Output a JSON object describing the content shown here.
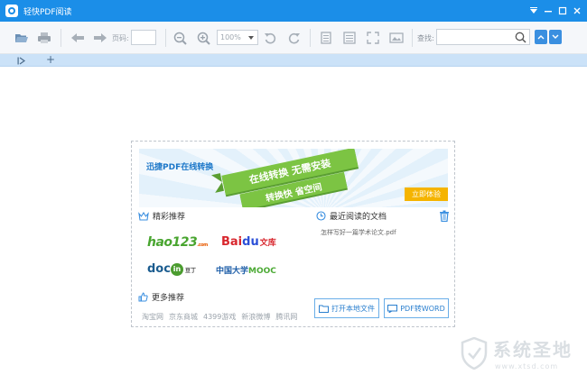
{
  "app": {
    "title": "轻快PDF阅读",
    "accent_color": "#1b8ee8"
  },
  "toolbar": {
    "page_label": "页码:",
    "page_value": "",
    "zoom_value": "100%",
    "find_label": "查找:",
    "find_value": ""
  },
  "tabs": {
    "new_tab": "+"
  },
  "start_panel": {
    "banner": {
      "title": "迅捷PDF在线转换",
      "ribbon_main": "在线转换 无需安装",
      "ribbon_sub": "转换快 省空间",
      "try_button": "立即体验"
    },
    "recommend": {
      "heading": "精彩推荐",
      "logos": [
        {
          "name": "hao123",
          "text": "hao123",
          "suffix": ".com"
        },
        {
          "name": "baidu-wenku",
          "text_a": "Bai",
          "text_b": "du",
          "text_c": "文库"
        },
        {
          "name": "docin",
          "text_a": "doc",
          "text_b": "in",
          "text_c": "豆丁"
        },
        {
          "name": "mooc",
          "text_a": "中国大学",
          "text_b": "MOOC"
        }
      ]
    },
    "more": {
      "heading": "更多推荐",
      "links": [
        "淘宝网",
        "京东商城",
        "4399游戏",
        "新浪微博",
        "腾讯网"
      ]
    },
    "recent": {
      "heading": "最近阅读的文档",
      "files": [
        "怎样写好一篇学术论文.pdf"
      ]
    },
    "buttons": {
      "open_local": "打开本地文件",
      "pdf_to_word": "PDF转WORD"
    }
  },
  "watermark": {
    "text": "系统圣地",
    "url": "www.xtsd.com"
  }
}
